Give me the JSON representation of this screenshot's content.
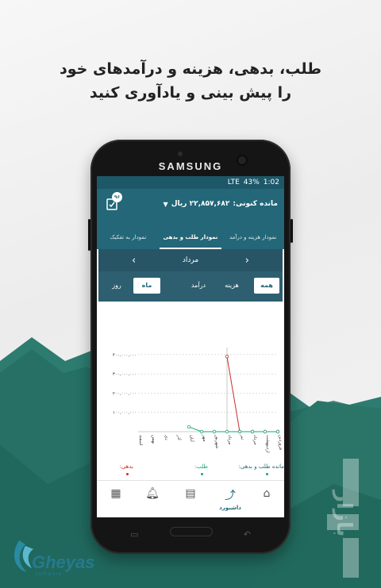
{
  "promo": {
    "line1": "طلب، بدهی، هزینه و درآمدهای خود",
    "line2": "را پیش بینی و یادآوری کنید"
  },
  "phone": {
    "brand": "SAMSUNG",
    "status": {
      "network": "LTE",
      "battery": "43%",
      "time": "1:02"
    }
  },
  "app": {
    "balance_label": "مانده کنونی:",
    "balance_value": "۲۲,۸۵۷,۶۸۲ ریال",
    "notif_count": "۹۶",
    "tabs": [
      "نمودار هزینه و درآمد",
      "نمودار طلب و بدهی",
      "نمودار به تفکیک"
    ],
    "active_tab": 1,
    "month": "مرداد",
    "filter_types": [
      "همه",
      "هزینه",
      "درآمد"
    ],
    "filter_type_selected": "همه",
    "period": [
      "ماه",
      "روز"
    ],
    "period_selected": "ماه"
  },
  "chart_data": {
    "type": "line",
    "title": "",
    "xlabel": "",
    "ylabel": "",
    "categories": [
      "فروردین",
      "اردیبهشت",
      "خرداد",
      "تیر",
      "مرداد",
      "شهریور",
      "مهر",
      "آبان",
      "آذر",
      "دی",
      "بهمن",
      "اسفند"
    ],
    "ytick_labels": [
      "۴۰۰,۰۰۰,۰۰۰",
      "۳۰۰,۰۰۰,۰۰۰",
      "۲۰۰,۰۰۰,۰۰۰",
      "۱۰۰,۰۰۰,۰۰۰"
    ],
    "yticks": [
      400000000,
      300000000,
      200000000,
      100000000
    ],
    "ylim": [
      0,
      420000000
    ],
    "grid": true,
    "series": [
      {
        "name": "طلب:",
        "color": "#cc2b2b",
        "values": [
          0,
          0,
          0,
          0,
          390000000,
          null,
          null,
          null,
          null,
          null,
          null,
          null
        ]
      },
      {
        "name": "مانده طلب و بدهی:",
        "color": "#1aa37a",
        "values": [
          0,
          0,
          0,
          0,
          0,
          0,
          0,
          25000000,
          null,
          null,
          null,
          null
        ]
      }
    ],
    "current_month_index": 4,
    "legend": [
      "مانده طلب و بدهی:",
      "طلب:",
      "بدهی:"
    ]
  },
  "nav": {
    "dashboard": "داشبورد",
    "icons": [
      "home-icon",
      "trend-icon",
      "clipboard-icon",
      "bell-icon",
      "apps-icon"
    ]
  },
  "logo": {
    "name": "Gheyas",
    "sub": "Software"
  },
  "watermark": "بازار",
  "colors": {
    "primary": "#236778",
    "accent": "#1aa37a",
    "debt": "#cc2b2b",
    "legend_credit": "#1aa37a"
  }
}
